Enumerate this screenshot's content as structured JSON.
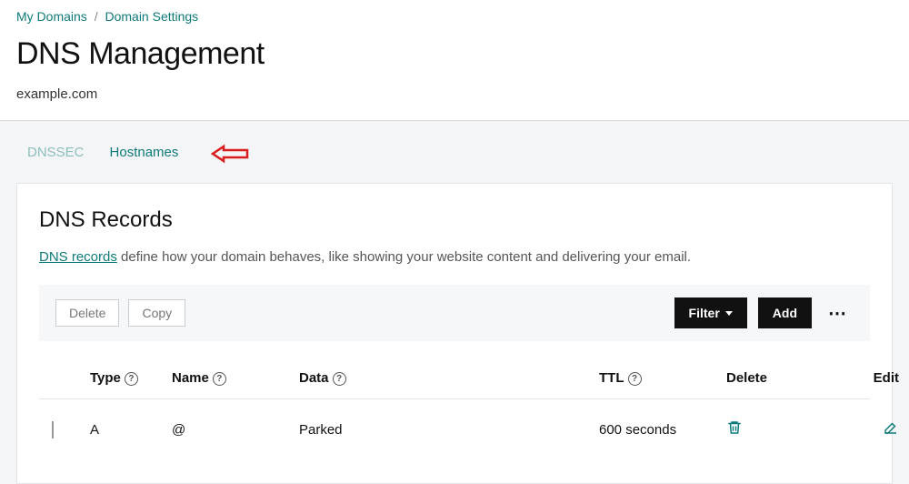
{
  "breadcrumb": {
    "item1": "My Domains",
    "item2": "Domain Settings"
  },
  "page_title": "DNS Management",
  "domain": "example.com",
  "tabs": {
    "dnssec": "DNSSEC",
    "hostnames": "Hostnames"
  },
  "records_card": {
    "title": "DNS Records",
    "link_text": "DNS records",
    "desc_rest": " define how your domain behaves, like showing your website content and delivering your email."
  },
  "toolbar": {
    "delete": "Delete",
    "copy": "Copy",
    "filter": "Filter",
    "add": "Add"
  },
  "columns": {
    "type": "Type",
    "name": "Name",
    "data": "Data",
    "ttl": "TTL",
    "delete": "Delete",
    "edit": "Edit"
  },
  "rows": [
    {
      "type": "A",
      "name": "@",
      "data": "Parked",
      "ttl": "600 seconds"
    }
  ]
}
